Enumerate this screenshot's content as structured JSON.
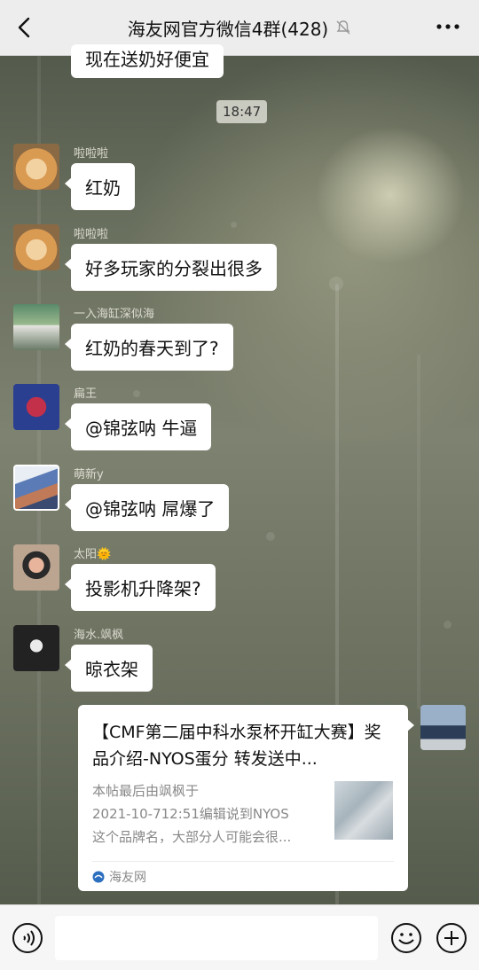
{
  "header": {
    "title": "海友网官方微信4群(428)"
  },
  "messages": {
    "partial_text": "现在送奶好便宜",
    "timestamp": "18:47",
    "items": [
      {
        "sender": "啦啦啦",
        "text": "红奶"
      },
      {
        "sender": "啦啦啦",
        "text": "好多玩家的分裂出很多"
      },
      {
        "sender": "一入海缸深似海",
        "text": "红奶的春天到了?"
      },
      {
        "sender": "扁王",
        "text": "@锦弦呐  牛逼"
      },
      {
        "sender": "萌新y",
        "text": "@锦弦呐  屌爆了"
      },
      {
        "sender": "太阳🌞",
        "text": "投影机升降架?"
      },
      {
        "sender": "海水.飒枫",
        "text": "晾衣架"
      }
    ]
  },
  "card": {
    "title": "【CMF第二届中科水泵杯开缸大赛】奖品介绍-NYOS蛋分 转发送中...",
    "desc_line1": "本帖最后由飒枫于",
    "desc_line2": "2021-10-712:51编辑说到NYOS",
    "desc_line3": "这个品牌名，大部分人可能会很...",
    "source": "海友网"
  },
  "icons": {
    "back": "chevron-left-icon",
    "mute": "bell-muted-icon",
    "more": "more-dots-icon",
    "voice": "voice-icon",
    "emoji": "emoji-icon",
    "plus": "plus-icon"
  },
  "colors": {
    "topbar": "#ededed",
    "bubble": "#ffffff",
    "sender_name": "#dcdcd0"
  }
}
